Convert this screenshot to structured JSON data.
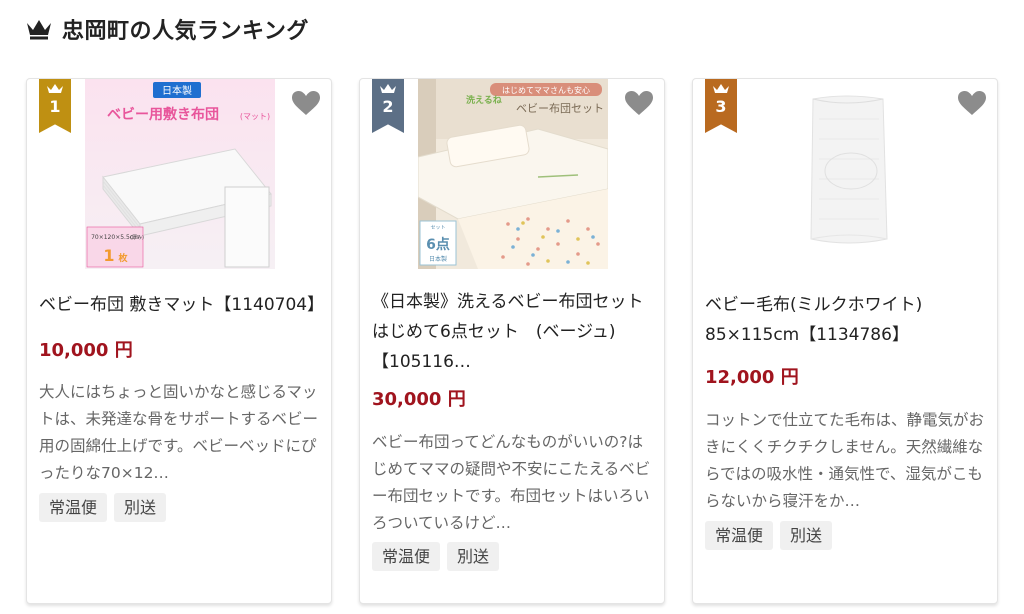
{
  "ranking": {
    "title": "忠岡町の人気ランキング",
    "icon": "crown-icon"
  },
  "colors": {
    "price": "#a0141e",
    "rank1": "#bf9012",
    "rank2": "#5c6f86",
    "rank3": "#b96a20"
  },
  "products": [
    {
      "rank": "1",
      "title": "ベビー布団 敷きマット【1140704】",
      "price": "10,000 円",
      "description": "大人にはちょっと固いかなと感じるマットは、未発達な骨をサポートするベビー用の固綿仕上げです。ベビーベッドにぴったりな70×12…",
      "tags": [
        "常温便",
        "別送"
      ],
      "image": {
        "badge": "日本製",
        "banner": "ベビー用敷き布団",
        "banner_tag": "(マット)",
        "size": "70×120×5.5cm",
        "size_note": "(厚み)",
        "count": "1",
        "count_unit": "枚"
      }
    },
    {
      "rank": "2",
      "title": "《日本製》洗えるベビー布団セット はじめて6点セット　(ベージュ)【105116…",
      "price": "30,000 円",
      "description": "ベビー布団ってどんなものがいいの?はじめてママの疑問や不安にこたえるベビー布団セットです。布団セットはいろいろついているけど…",
      "tags": [
        "常温便",
        "別送"
      ],
      "image": {
        "tagline": "はじめてママさんも安心",
        "banner": "ベビー布団セット",
        "logo": "洗えるね",
        "count_label": "6点",
        "count_sub": "セット",
        "made": "日本製"
      }
    },
    {
      "rank": "3",
      "title": "ベビー毛布(ミルクホワイト)　85×115cm【1134786】",
      "price": "12,000 円",
      "description": "コットンで仕立てた毛布は、静電気がおきにくくチクチクしません。天然繊維ならではの吸水性・通気性で、湿気がこもらないから寝汗をか…",
      "tags": [
        "常温便",
        "別送"
      ],
      "image": {}
    }
  ]
}
